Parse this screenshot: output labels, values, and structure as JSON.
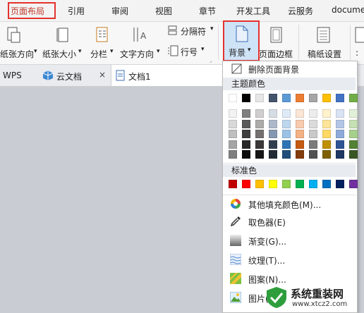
{
  "ribbon_tabs": [
    "页面布局",
    "引用",
    "审阅",
    "视图",
    "章节",
    "开发工具",
    "云服务",
    "docume"
  ],
  "ribbon": {
    "orientation": "纸张方向",
    "size": "纸张大小",
    "columns": "分栏",
    "text_direction": "文字方向",
    "separator": "分隔符",
    "line_number": "行号",
    "background": "背景",
    "page_border": "页面边框",
    "grid_paper": "稿纸设置"
  },
  "doc_tabs": [
    "WPS",
    "云文档",
    "文档1"
  ],
  "menu": {
    "remove_bg": "删除页面背景",
    "theme_colors_title": "主题颜色",
    "standard_colors_title": "标准色",
    "items": [
      "其他填充颜色(M)...",
      "取色器(E)",
      "渐变(G)...",
      "纹理(T)...",
      "图案(N)...",
      "图片("
    ]
  },
  "theme_top_row": [
    "#ffffff",
    "#000000",
    "#e7e6e6",
    "#44546a",
    "#5b9bd5",
    "#ed7d31",
    "#a5a5a5",
    "#ffc000",
    "#4472c4",
    "#70ad47"
  ],
  "theme_shades": [
    [
      "#f2f2f2",
      "#7f7f7f",
      "#d0cece",
      "#d6dce4",
      "#deebf6",
      "#fbe5d5",
      "#ededed",
      "#fff2cc",
      "#dae3f3",
      "#e2efd9"
    ],
    [
      "#d8d8d8",
      "#595959",
      "#aeabab",
      "#adb9ca",
      "#bdd7ee",
      "#f7cbac",
      "#dbdbdb",
      "#fee599",
      "#b4c6e7",
      "#c5e0b3"
    ],
    [
      "#bfbfbf",
      "#3f3f3f",
      "#757070",
      "#8496b0",
      "#9cc3e5",
      "#f4b183",
      "#c9c9c9",
      "#ffd965",
      "#8eaadb",
      "#a8d08d"
    ],
    [
      "#a5a5a5",
      "#262626",
      "#3a3838",
      "#323f4f",
      "#2e75b5",
      "#c55a11",
      "#7b7b7b",
      "#bf9000",
      "#2f5496",
      "#538135"
    ],
    [
      "#7f7f7f",
      "#0c0c0c",
      "#171616",
      "#222a35",
      "#1e4e79",
      "#833c0b",
      "#525252",
      "#7f6000",
      "#1f3864",
      "#375623"
    ]
  ],
  "standard_colors": [
    "#c00000",
    "#ff0000",
    "#ffc000",
    "#ffff00",
    "#92d050",
    "#00b050",
    "#00b0f0",
    "#0070c0",
    "#002060",
    "#7030a0"
  ],
  "watermark": {
    "title": "系统重装网",
    "url": "www.xtcz2.com"
  }
}
